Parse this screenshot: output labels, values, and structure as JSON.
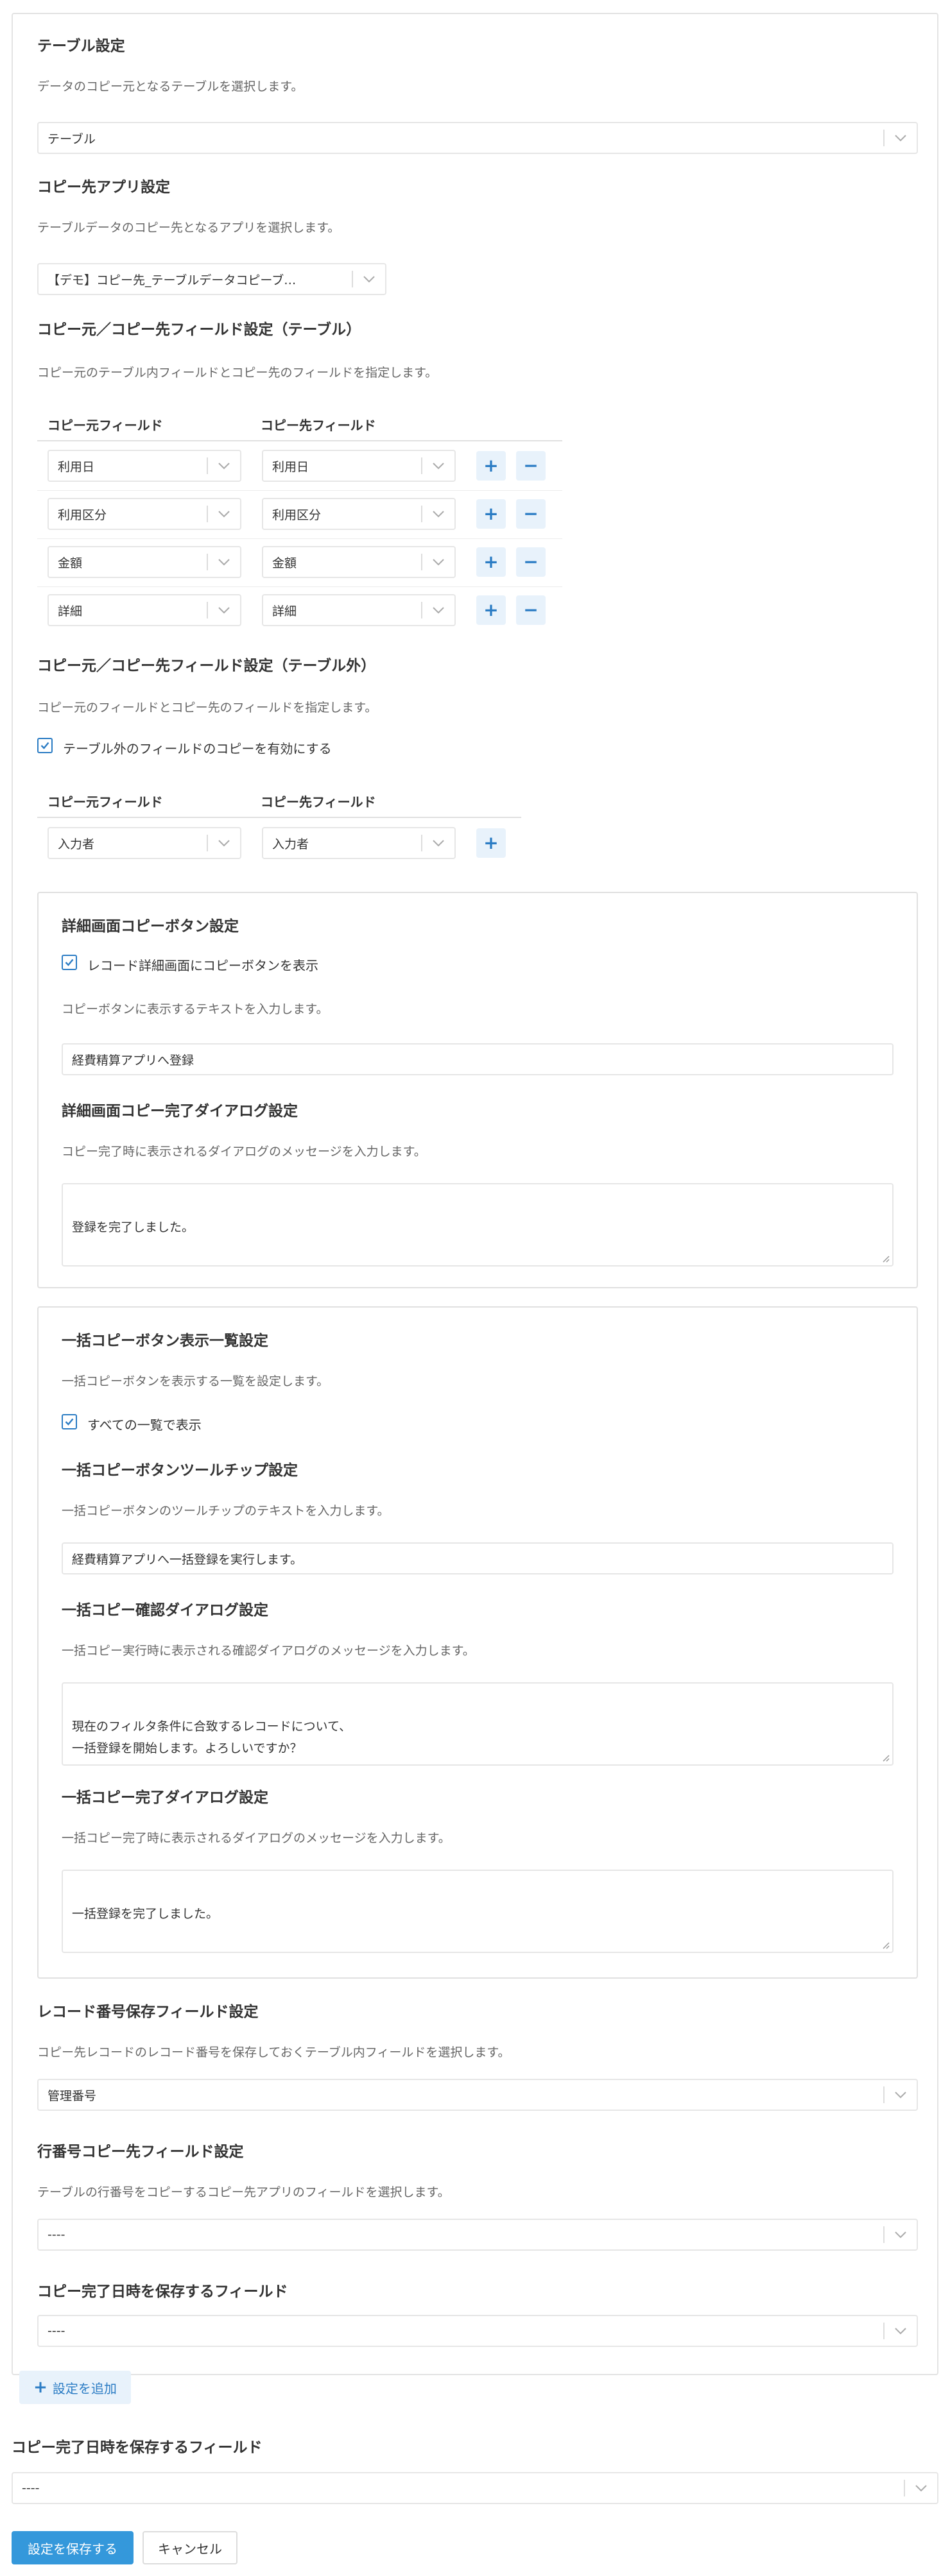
{
  "table_settings": {
    "heading": "テーブル設定",
    "description": "データのコピー元となるテーブルを選択します。",
    "value": "テーブル"
  },
  "target_app": {
    "heading": "コピー先アプリ設定",
    "description": "テーブルデータのコピー先となるアプリを選択します。",
    "value": "【デモ】コピー先_テーブルデータコピーブ…"
  },
  "table_fields": {
    "heading": "コピー元／コピー先フィールド設定（テーブル）",
    "description": "コピー元のテーブル内フィールドとコピー先のフィールドを指定します。",
    "col_source": "コピー元フィールド",
    "col_target": "コピー先フィールド",
    "rows": [
      {
        "source": "利用日",
        "target": "利用日"
      },
      {
        "source": "利用区分",
        "target": "利用区分"
      },
      {
        "source": "金額",
        "target": "金額"
      },
      {
        "source": "詳細",
        "target": "詳細"
      }
    ],
    "add_symbol": "+",
    "remove_symbol": "−"
  },
  "outer_fields": {
    "heading": "コピー元／コピー先フィールド設定（テーブル外）",
    "description": "コピー元のフィールドとコピー先のフィールドを指定します。",
    "enable_label": "テーブル外のフィールドのコピーを有効にする",
    "col_source": "コピー元フィールド",
    "col_target": "コピー先フィールド",
    "rows": [
      {
        "source": "入力者",
        "target": "入力者"
      }
    ],
    "add_symbol": "+"
  },
  "detail_button": {
    "heading": "詳細画面コピーボタン設定",
    "show_label": "レコード詳細画面にコピーボタンを表示",
    "text_description": "コピーボタンに表示するテキストを入力します。",
    "text_value": "経費精算アプリへ登録",
    "dialog_heading": "詳細画面コピー完了ダイアログ設定",
    "dialog_description": "コピー完了時に表示されるダイアログのメッセージを入力します。",
    "dialog_value": "登録を完了しました。"
  },
  "bulk": {
    "heading": "一括コピーボタン表示一覧設定",
    "description": "一括コピーボタンを表示する一覧を設定します。",
    "all_lists_label": "すべての一覧で表示",
    "tooltip_heading": "一括コピーボタンツールチップ設定",
    "tooltip_description": "一括コピーボタンのツールチップのテキストを入力します。",
    "tooltip_value": "経費精算アプリへ一括登録を実行します。",
    "confirm_heading": "一括コピー確認ダイアログ設定",
    "confirm_description": "一括コピー実行時に表示される確認ダイアログのメッセージを入力します。",
    "confirm_value": "現在のフィルタ条件に合致するレコードについて、\n一括登録を開始します。よろしいですか？",
    "complete_heading": "一括コピー完了ダイアログ設定",
    "complete_description": "一括コピー完了時に表示されるダイアログのメッセージを入力します。",
    "complete_value": "一括登録を完了しました。"
  },
  "record_number": {
    "heading": "レコード番号保存フィールド設定",
    "description": "コピー先レコードのレコード番号を保存しておくテーブル内フィールドを選択します。",
    "value": "管理番号"
  },
  "row_number": {
    "heading": "行番号コピー先フィールド設定",
    "description": "テーブルの行番号をコピーするコピー先アプリのフィールドを選択します。",
    "value": "----"
  },
  "inner_datetime": {
    "heading": "コピー完了日時を保存するフィールド",
    "value": "----"
  },
  "add_setting_label": "設定を追加",
  "add_setting_symbol": "+",
  "outer_datetime": {
    "heading": "コピー完了日時を保存するフィールド",
    "value": "----"
  },
  "footer": {
    "save_label": "設定を保存する",
    "cancel_label": "キャンセル"
  },
  "colors": {
    "accent": "#3498db",
    "accent_text": "#2b7cc4",
    "accent_light": "#e8f2fb",
    "border": "#e3e3e3"
  }
}
